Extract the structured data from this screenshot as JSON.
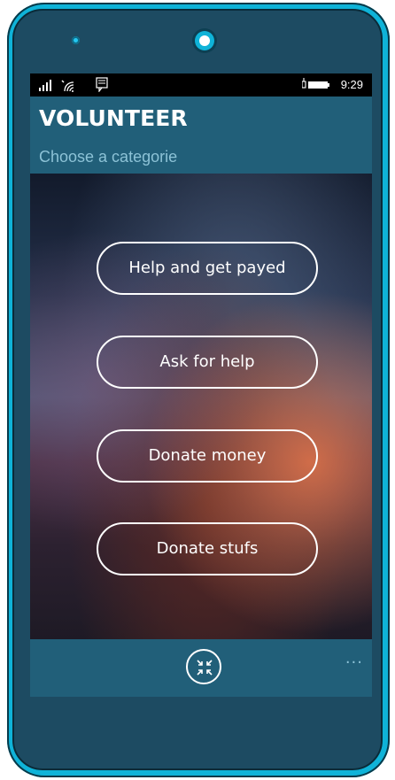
{
  "statusbar": {
    "time": "9:29",
    "icons": [
      "signal-icon",
      "wifi-icon",
      "message-icon",
      "battery-icon"
    ]
  },
  "header": {
    "title": "VOLUNTEER",
    "subtitle": "Choose a categorie"
  },
  "actions": [
    {
      "label": "Help and get payed"
    },
    {
      "label": "Ask for help"
    },
    {
      "label": "Donate money"
    },
    {
      "label": "Donate stufs"
    }
  ],
  "appbar": {
    "more": "...",
    "primary_icon": "collapse-icon"
  },
  "colors": {
    "phone_shell": "#0fb3d8",
    "phone_body": "#1d4b62",
    "header": "#215f79",
    "subtitle": "#8cc2d6",
    "button_border": "#ffffff"
  }
}
